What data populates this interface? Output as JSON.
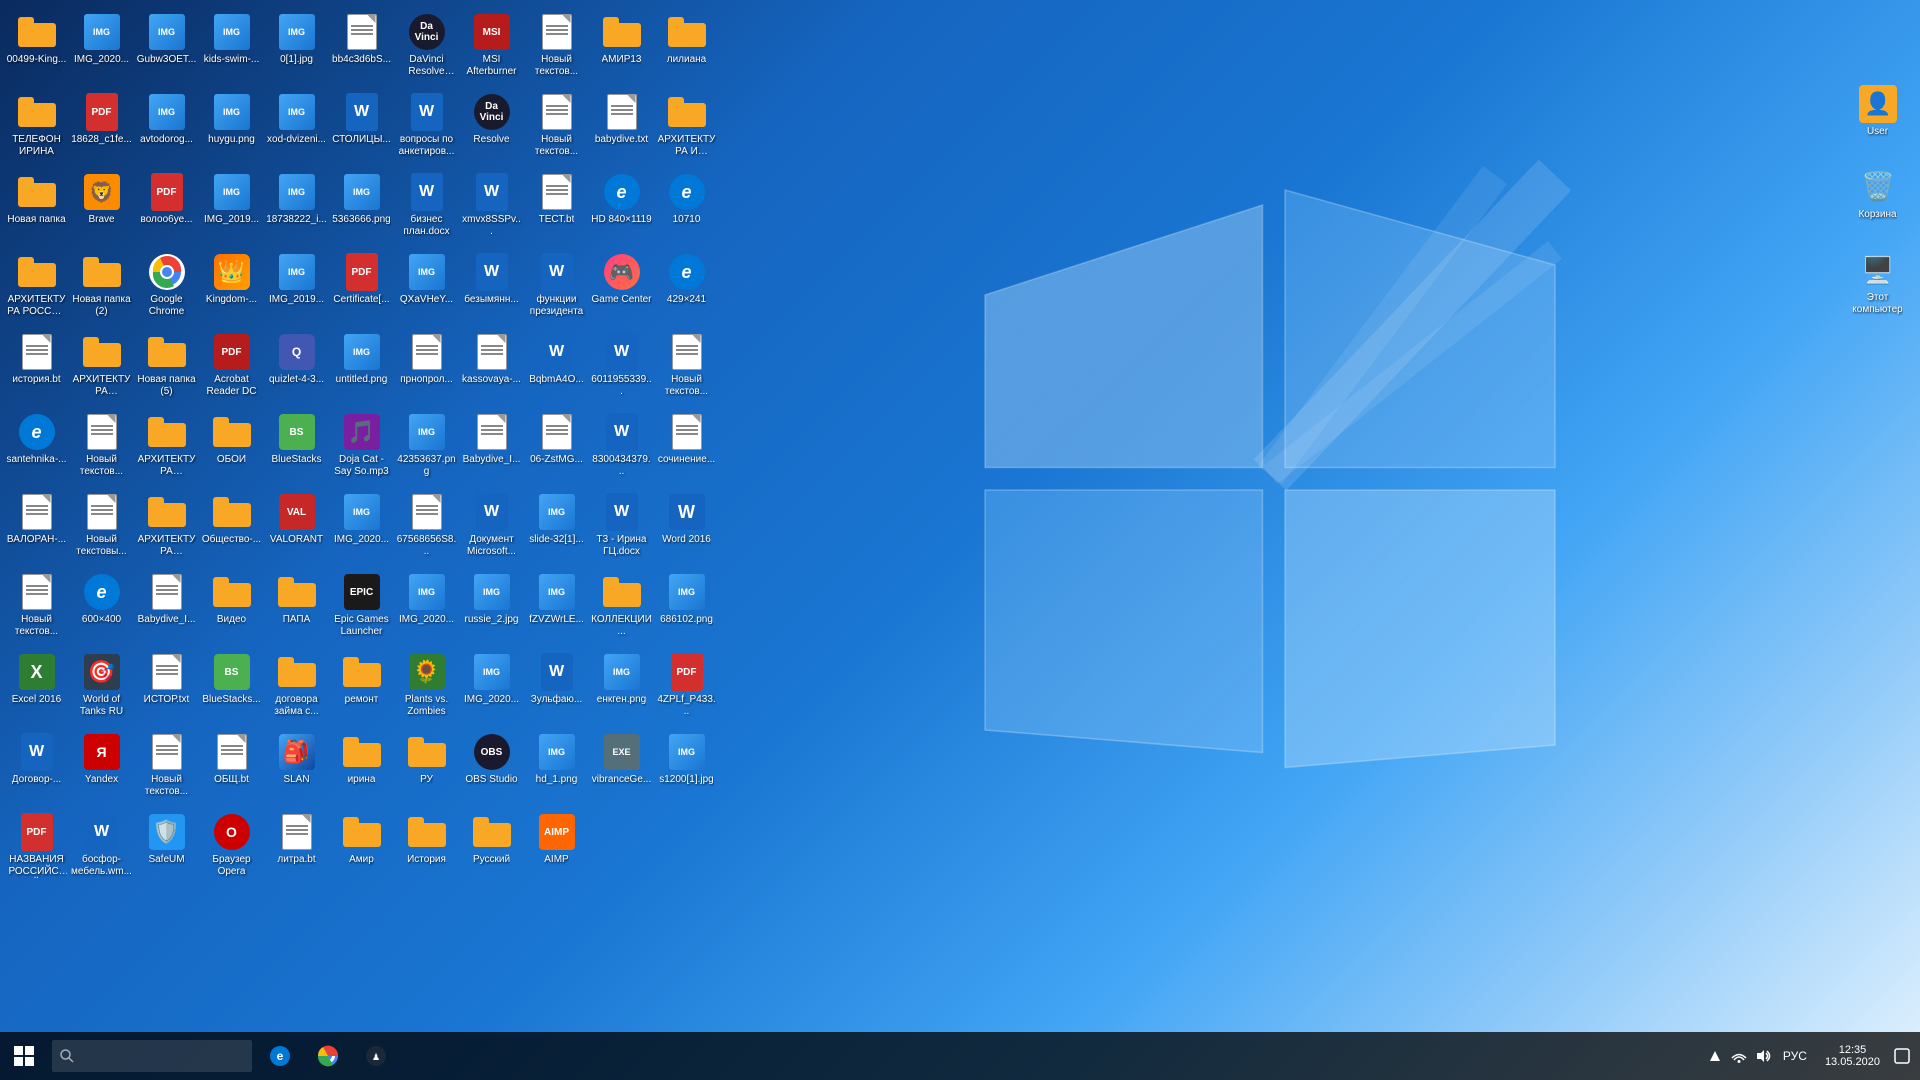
{
  "desktop": {
    "icons": [
      {
        "id": "row1-1",
        "label": "00499-King...",
        "type": "folder"
      },
      {
        "id": "row1-2",
        "label": "IMG_2020...",
        "type": "png"
      },
      {
        "id": "row1-3",
        "label": "Gubw3OET...",
        "type": "png"
      },
      {
        "id": "row1-4",
        "label": "kids-swim-...",
        "type": "png"
      },
      {
        "id": "row1-5",
        "label": "0[1].jpg",
        "type": "png"
      },
      {
        "id": "row1-6",
        "label": "bb4c3d6bS...",
        "type": "txt"
      },
      {
        "id": "row1-7",
        "label": "DaVinci Resolve Pro...",
        "type": "resolve"
      },
      {
        "id": "row1-8",
        "label": "MSI Afterburner",
        "type": "msi"
      },
      {
        "id": "row1-9",
        "label": "Новый текстов...",
        "type": "txt"
      },
      {
        "id": "row1-10",
        "label": "АМИР13",
        "type": "folder"
      },
      {
        "id": "row1-11",
        "label": "лилиана",
        "type": "folder"
      },
      {
        "id": "row1-12",
        "label": "ТЕЛЕФОН ИРИНА",
        "type": "folder"
      },
      {
        "id": "row2-1",
        "label": "18628_c1fe...",
        "type": "pdf"
      },
      {
        "id": "row2-2",
        "label": "avtodorog...",
        "type": "png"
      },
      {
        "id": "row2-3",
        "label": "huygu.png",
        "type": "png"
      },
      {
        "id": "row2-4",
        "label": "xod-dvizeni...",
        "type": "png"
      },
      {
        "id": "row2-5",
        "label": "СТОЛИЦЫ...",
        "type": "word"
      },
      {
        "id": "row2-6",
        "label": "вопросы по анкетиров...",
        "type": "word"
      },
      {
        "id": "row2-7",
        "label": "Resolve",
        "type": "resolve"
      },
      {
        "id": "row2-8",
        "label": "Новый текстов...",
        "type": "txt"
      },
      {
        "id": "row2-9",
        "label": "babydive.txt",
        "type": "txt"
      },
      {
        "id": "row2-10",
        "label": "АРХИТЕКТУРА И СКУЛЬП...",
        "type": "folder"
      },
      {
        "id": "row2-11",
        "label": "Новая папка",
        "type": "folder"
      },
      {
        "id": "row2-12",
        "label": "Brave",
        "type": "brave"
      },
      {
        "id": "row3-1",
        "label": "волоо6уе...",
        "type": "pdf"
      },
      {
        "id": "row3-2",
        "label": "IMG_2019...",
        "type": "png"
      },
      {
        "id": "row3-3",
        "label": "18738222_i...",
        "type": "png"
      },
      {
        "id": "row3-4",
        "label": "5363666.png",
        "type": "png"
      },
      {
        "id": "row3-5",
        "label": "бизнес план.docx",
        "type": "word"
      },
      {
        "id": "row3-6",
        "label": "xmvx8SSPv...",
        "type": "word"
      },
      {
        "id": "row3-7",
        "label": "ТЕСТ.bt",
        "type": "txt"
      },
      {
        "id": "row3-8",
        "label": "HD 840×1119",
        "type": "edge"
      },
      {
        "id": "row3-9",
        "label": "10710",
        "type": "edge"
      },
      {
        "id": "row3-10",
        "label": "АРХИТЕКТУРА РОССИЯ И...",
        "type": "folder"
      },
      {
        "id": "row3-11",
        "label": "Новая папка (2)",
        "type": "folder"
      },
      {
        "id": "row3-12",
        "label": "Google Chrome",
        "type": "chrome"
      },
      {
        "id": "row4-1",
        "label": "Kingdom-...",
        "type": "kingdom"
      },
      {
        "id": "row4-2",
        "label": "IMG_2019...",
        "type": "png"
      },
      {
        "id": "row4-3",
        "label": "Certificate[...",
        "type": "pdf"
      },
      {
        "id": "row4-4",
        "label": "QXaVHeY...",
        "type": "png"
      },
      {
        "id": "row4-5",
        "label": "безымянн...",
        "type": "word"
      },
      {
        "id": "row4-6",
        "label": "функции президента",
        "type": "word"
      },
      {
        "id": "row4-7",
        "label": "Game Center",
        "type": "gamecenter"
      },
      {
        "id": "row4-8",
        "label": "429×241",
        "type": "edge"
      },
      {
        "id": "row4-9",
        "label": "история.bt",
        "type": "txt"
      },
      {
        "id": "row4-10",
        "label": "АРХИТЕКТУРА ВЛАДИМИР",
        "type": "folder"
      },
      {
        "id": "row4-11",
        "label": "Новая папка (5)",
        "type": "folder"
      },
      {
        "id": "row4-12",
        "label": "Acrobat Reader DC",
        "type": "acrobat"
      },
      {
        "id": "row5-1",
        "label": "quizlet-4-3...",
        "type": "quizlet"
      },
      {
        "id": "row5-2",
        "label": "untitled.png",
        "type": "png"
      },
      {
        "id": "row5-3",
        "label": "прнопрол...",
        "type": "txt"
      },
      {
        "id": "row5-4",
        "label": "kassovaya-...",
        "type": "txt"
      },
      {
        "id": "row5-5",
        "label": "BqbmA4O...",
        "type": "word"
      },
      {
        "id": "row5-6",
        "label": "6011955339...",
        "type": "word"
      },
      {
        "id": "row5-7",
        "label": "Новый текстов...",
        "type": "txt"
      },
      {
        "id": "row5-8",
        "label": "santehnika-...",
        "type": "edge"
      },
      {
        "id": "row5-9",
        "label": "Новый текстов...",
        "type": "txt"
      },
      {
        "id": "row5-10",
        "label": "АРХИТЕКТУРА НОВГОРОД",
        "type": "folder"
      },
      {
        "id": "row5-11",
        "label": "ОБОИ",
        "type": "folder"
      },
      {
        "id": "row5-12",
        "label": "BlueStacks",
        "type": "bluestacks"
      },
      {
        "id": "row6-1",
        "label": "Doja Cat - Say So.mp3",
        "type": "audio"
      },
      {
        "id": "row6-2",
        "label": "42353637.png",
        "type": "png"
      },
      {
        "id": "row6-3",
        "label": "Babydive_I...",
        "type": "txt"
      },
      {
        "id": "row6-4",
        "label": "06-ZstMG...",
        "type": "txt"
      },
      {
        "id": "row6-5",
        "label": "8300434379...",
        "type": "word"
      },
      {
        "id": "row6-6",
        "label": "сочинение...",
        "type": "txt"
      },
      {
        "id": "row6-7",
        "label": "ВАЛОРАН-...",
        "type": "txt"
      },
      {
        "id": "row6-8",
        "label": "Новый текстовы...",
        "type": "txt"
      },
      {
        "id": "row6-9",
        "label": "АРХИТЕКТУРА СКУЛЬПТУ...",
        "type": "folder"
      },
      {
        "id": "row6-10",
        "label": "Общество-...",
        "type": "folder"
      },
      {
        "id": "row6-11",
        "label": "VALORANT",
        "type": "valorant"
      },
      {
        "id": "row7-1",
        "label": "IMG_2020...",
        "type": "png"
      },
      {
        "id": "row7-2",
        "label": "67568656S8...",
        "type": "txt"
      },
      {
        "id": "row7-3",
        "label": "Документ Microsoft...",
        "type": "word"
      },
      {
        "id": "row7-4",
        "label": "slide-32[1]...",
        "type": "png"
      },
      {
        "id": "row7-5",
        "label": "Т3 - Ирина ГЦ.docx",
        "type": "word"
      },
      {
        "id": "row7-6",
        "label": "Word 2016",
        "type": "word2016"
      },
      {
        "id": "row7-7",
        "label": "Новый текстов...",
        "type": "txt"
      },
      {
        "id": "row7-8",
        "label": "600×400",
        "type": "edge"
      },
      {
        "id": "row7-9",
        "label": "Babydive_I...",
        "type": "txt"
      },
      {
        "id": "row7-10",
        "label": "Видео",
        "type": "folder"
      },
      {
        "id": "row7-11",
        "label": "ПАПА",
        "type": "folder"
      },
      {
        "id": "row7-12",
        "label": "Epic Games Launcher",
        "type": "epic"
      },
      {
        "id": "row8-1",
        "label": "IMG_2020...",
        "type": "png"
      },
      {
        "id": "row8-2",
        "label": "russie_2.jpg",
        "type": "png"
      },
      {
        "id": "row8-3",
        "label": "fZVZWrLE...",
        "type": "png"
      },
      {
        "id": "row8-4",
        "label": "КОЛЛЕКЦИИ...",
        "type": "folder"
      },
      {
        "id": "row8-5",
        "label": "686102.png",
        "type": "png"
      },
      {
        "id": "row8-6",
        "label": "Excel 2016",
        "type": "excel2016"
      },
      {
        "id": "row8-7",
        "label": "World of Tanks RU",
        "type": "wot"
      },
      {
        "id": "row8-8",
        "label": "ИСТОР.txt",
        "type": "txt"
      },
      {
        "id": "row8-9",
        "label": "BlueStacks...",
        "type": "bluestacks"
      },
      {
        "id": "row8-10",
        "label": "договора займа с...",
        "type": "folder"
      },
      {
        "id": "row8-11",
        "label": "ремонт",
        "type": "folder"
      },
      {
        "id": "row8-12",
        "label": "Plants vs. Zombies",
        "type": "pvz"
      },
      {
        "id": "row9-1",
        "label": "IMG_2020...",
        "type": "png"
      },
      {
        "id": "row9-2",
        "label": "Зульфаю...",
        "type": "word"
      },
      {
        "id": "row9-3",
        "label": "енкген.png",
        "type": "png"
      },
      {
        "id": "row9-4",
        "label": "4ZPLf_P433...",
        "type": "pdf"
      },
      {
        "id": "row9-5",
        "label": "Договор-...",
        "type": "word"
      },
      {
        "id": "row9-6",
        "label": "Yandex",
        "type": "yandex"
      },
      {
        "id": "row9-7",
        "label": "Новый текстов...",
        "type": "txt"
      },
      {
        "id": "row9-8",
        "label": "ОБЩ.bt",
        "type": "txt"
      },
      {
        "id": "row9-9",
        "label": "SLAN",
        "type": "slan"
      },
      {
        "id": "row9-10",
        "label": "ирина",
        "type": "folder"
      },
      {
        "id": "row9-11",
        "label": "РУ",
        "type": "folder"
      },
      {
        "id": "row9-12",
        "label": "OBS Studio",
        "type": "obs"
      },
      {
        "id": "row10-1",
        "label": "hd_1.png",
        "type": "png"
      },
      {
        "id": "row10-2",
        "label": "vibranceGe...",
        "type": "exe"
      },
      {
        "id": "row10-3",
        "label": "s1200[1].jpg",
        "type": "png"
      },
      {
        "id": "row10-4",
        "label": "НАЗВАНИЯ РОССИЙСКОЙ...",
        "type": "pdf"
      },
      {
        "id": "row10-5",
        "label": "босфор-мебель.wm...",
        "type": "word"
      },
      {
        "id": "row10-6",
        "label": "SafeUM",
        "type": "safeup"
      },
      {
        "id": "row10-7",
        "label": "Браузер Opera",
        "type": "opera"
      },
      {
        "id": "row10-8",
        "label": "литра.bt",
        "type": "txt"
      },
      {
        "id": "row10-9",
        "label": "Амир",
        "type": "folder"
      },
      {
        "id": "row10-10",
        "label": "История",
        "type": "folder"
      },
      {
        "id": "row10-11",
        "label": "Русский",
        "type": "folder"
      },
      {
        "id": "row10-12",
        "label": "AIMP",
        "type": "aimp"
      }
    ]
  },
  "desktop_right": [
    {
      "id": "user",
      "label": "User",
      "type": "user"
    },
    {
      "id": "recycle",
      "label": "Корзина",
      "type": "recycle"
    },
    {
      "id": "computer",
      "label": "Этот компьютер",
      "type": "computer"
    }
  ],
  "taskbar": {
    "start_label": "⊞",
    "search_placeholder": "🔍",
    "buttons": [
      "edge",
      "steam"
    ],
    "tray": {
      "time": "12:35",
      "date": "13.05.2020",
      "lang": "РУС"
    }
  }
}
